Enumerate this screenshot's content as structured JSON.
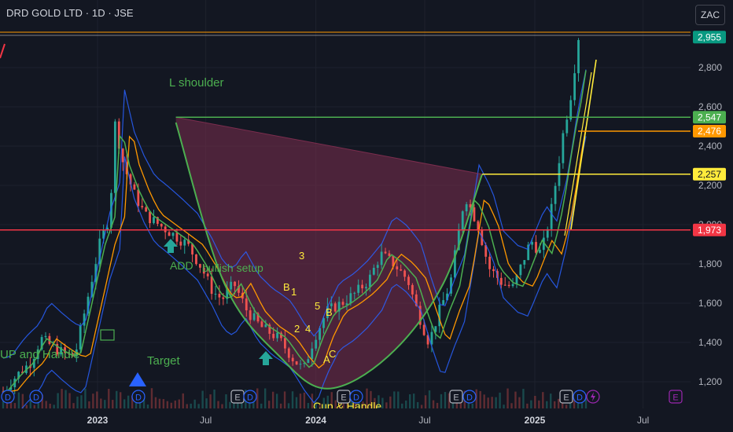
{
  "header": {
    "title": "DRD GOLD LTD · 1D · JSE",
    "currency": "ZAC"
  },
  "colors": {
    "background": "#131722",
    "up_candle": "#26a69a",
    "down_candle": "#ef5350",
    "green_line": "#4caf50",
    "red_line": "#f23645",
    "yellow_line": "#ffeb3b",
    "orange_line": "#ff9800",
    "blue_band": "#2962ff",
    "cup_fill": "#7b2d4e"
  },
  "chart_data": {
    "type": "candlestick",
    "y_range": [
      1130,
      3020
    ],
    "y_ticks": [
      "1,200",
      "1,400",
      "1,600",
      "1,800",
      "2,000",
      "2,200",
      "2,400",
      "2,600",
      "2,800"
    ],
    "x_ticks": [
      {
        "label": "2023",
        "bold": true
      },
      {
        "label": "Jul",
        "bold": false
      },
      {
        "label": "2024",
        "bold": true
      },
      {
        "label": "Jul",
        "bold": false
      },
      {
        "label": "2025",
        "bold": true
      },
      {
        "label": "Jul",
        "bold": false
      }
    ],
    "price_markers": [
      {
        "label": "2,955",
        "value": 2955,
        "color": "#089981"
      },
      {
        "label": "2,547",
        "value": 2547,
        "color": "#4caf50"
      },
      {
        "label": "2,476",
        "value": 2476,
        "color": "#ff9800"
      },
      {
        "label": "2,257",
        "value": 2257,
        "color": "#ffeb3b"
      },
      {
        "label": "1,973",
        "value": 1973,
        "color": "#f23645"
      }
    ],
    "price_path": [
      [
        "2022-12-01",
        1150
      ],
      [
        "2022-12-20",
        1230
      ],
      [
        "2023-01-10",
        1300
      ],
      [
        "2023-01-25",
        1420
      ],
      [
        "2023-02-10",
        1380
      ],
      [
        "2023-03-01",
        1340
      ],
      [
        "2023-03-15",
        1330
      ],
      [
        "2023-04-01",
        1600
      ],
      [
        "2023-04-20",
        1900
      ],
      [
        "2023-05-05",
        2050
      ],
      [
        "2023-05-12",
        2520
      ],
      [
        "2023-05-25",
        2300
      ],
      [
        "2023-06-10",
        2150
      ],
      [
        "2023-06-25",
        2050
      ],
      [
        "2023-07-15",
        2000
      ],
      [
        "2023-08-05",
        1950
      ],
      [
        "2023-08-25",
        1900
      ],
      [
        "2023-09-15",
        1780
      ],
      [
        "2023-10-01",
        1660
      ],
      [
        "2023-10-15",
        1620
      ],
      [
        "2023-11-01",
        1700
      ],
      [
        "2023-11-20",
        1560
      ],
      [
        "2023-12-10",
        1480
      ],
      [
        "2024-01-05",
        1420
      ],
      [
        "2024-01-25",
        1320
      ],
      [
        "2024-02-10",
        1260
      ],
      [
        "2024-02-25",
        1420
      ],
      [
        "2024-03-15",
        1560
      ],
      [
        "2024-04-05",
        1600
      ],
      [
        "2024-04-25",
        1650
      ],
      [
        "2024-05-15",
        1720
      ],
      [
        "2024-06-01",
        1850
      ],
      [
        "2024-06-20",
        1800
      ],
      [
        "2024-07-10",
        1720
      ],
      [
        "2024-07-25",
        1550
      ],
      [
        "2024-08-10",
        1400
      ],
      [
        "2024-08-25",
        1560
      ],
      [
        "2024-09-10",
        1700
      ],
      [
        "2024-10-01",
        2150
      ],
      [
        "2024-10-20",
        2000
      ],
      [
        "2024-11-05",
        1780
      ],
      [
        "2024-11-25",
        1700
      ],
      [
        "2024-12-10",
        1680
      ],
      [
        "2025-01-05",
        1920
      ],
      [
        "2025-01-20",
        1850
      ],
      [
        "2025-02-05",
        2100
      ],
      [
        "2025-02-20",
        2450
      ],
      [
        "2025-03-05",
        2680
      ],
      [
        "2025-03-15",
        2955
      ]
    ],
    "cup_curve": [
      [
        "2023-05-12",
        2520
      ],
      [
        "2023-08-01",
        1700
      ],
      [
        "2023-11-01",
        1330
      ],
      [
        "2024-01-20",
        1165
      ],
      [
        "2024-05-01",
        1330
      ],
      [
        "2024-08-01",
        1700
      ],
      [
        "2024-10-05",
        2257
      ]
    ],
    "pennant_line": [
      [
        "2023-05-12",
        2547
      ],
      [
        "2024-10-05",
        2257
      ]
    ],
    "candle_count": 150
  },
  "annotations": {
    "l_shoulder": "L shoulder",
    "add": "ADD",
    "bullish_setup": "bullish setup",
    "cup_handle_left": "UP and Handle",
    "target": "Target",
    "cup_handle_bottom": "Cup & Handle",
    "wave_labels": [
      "3",
      "1",
      "B",
      "2",
      "4",
      "5",
      "B",
      "A",
      "C"
    ]
  },
  "event_badges": {
    "dividend": "D",
    "earnings": "E"
  }
}
